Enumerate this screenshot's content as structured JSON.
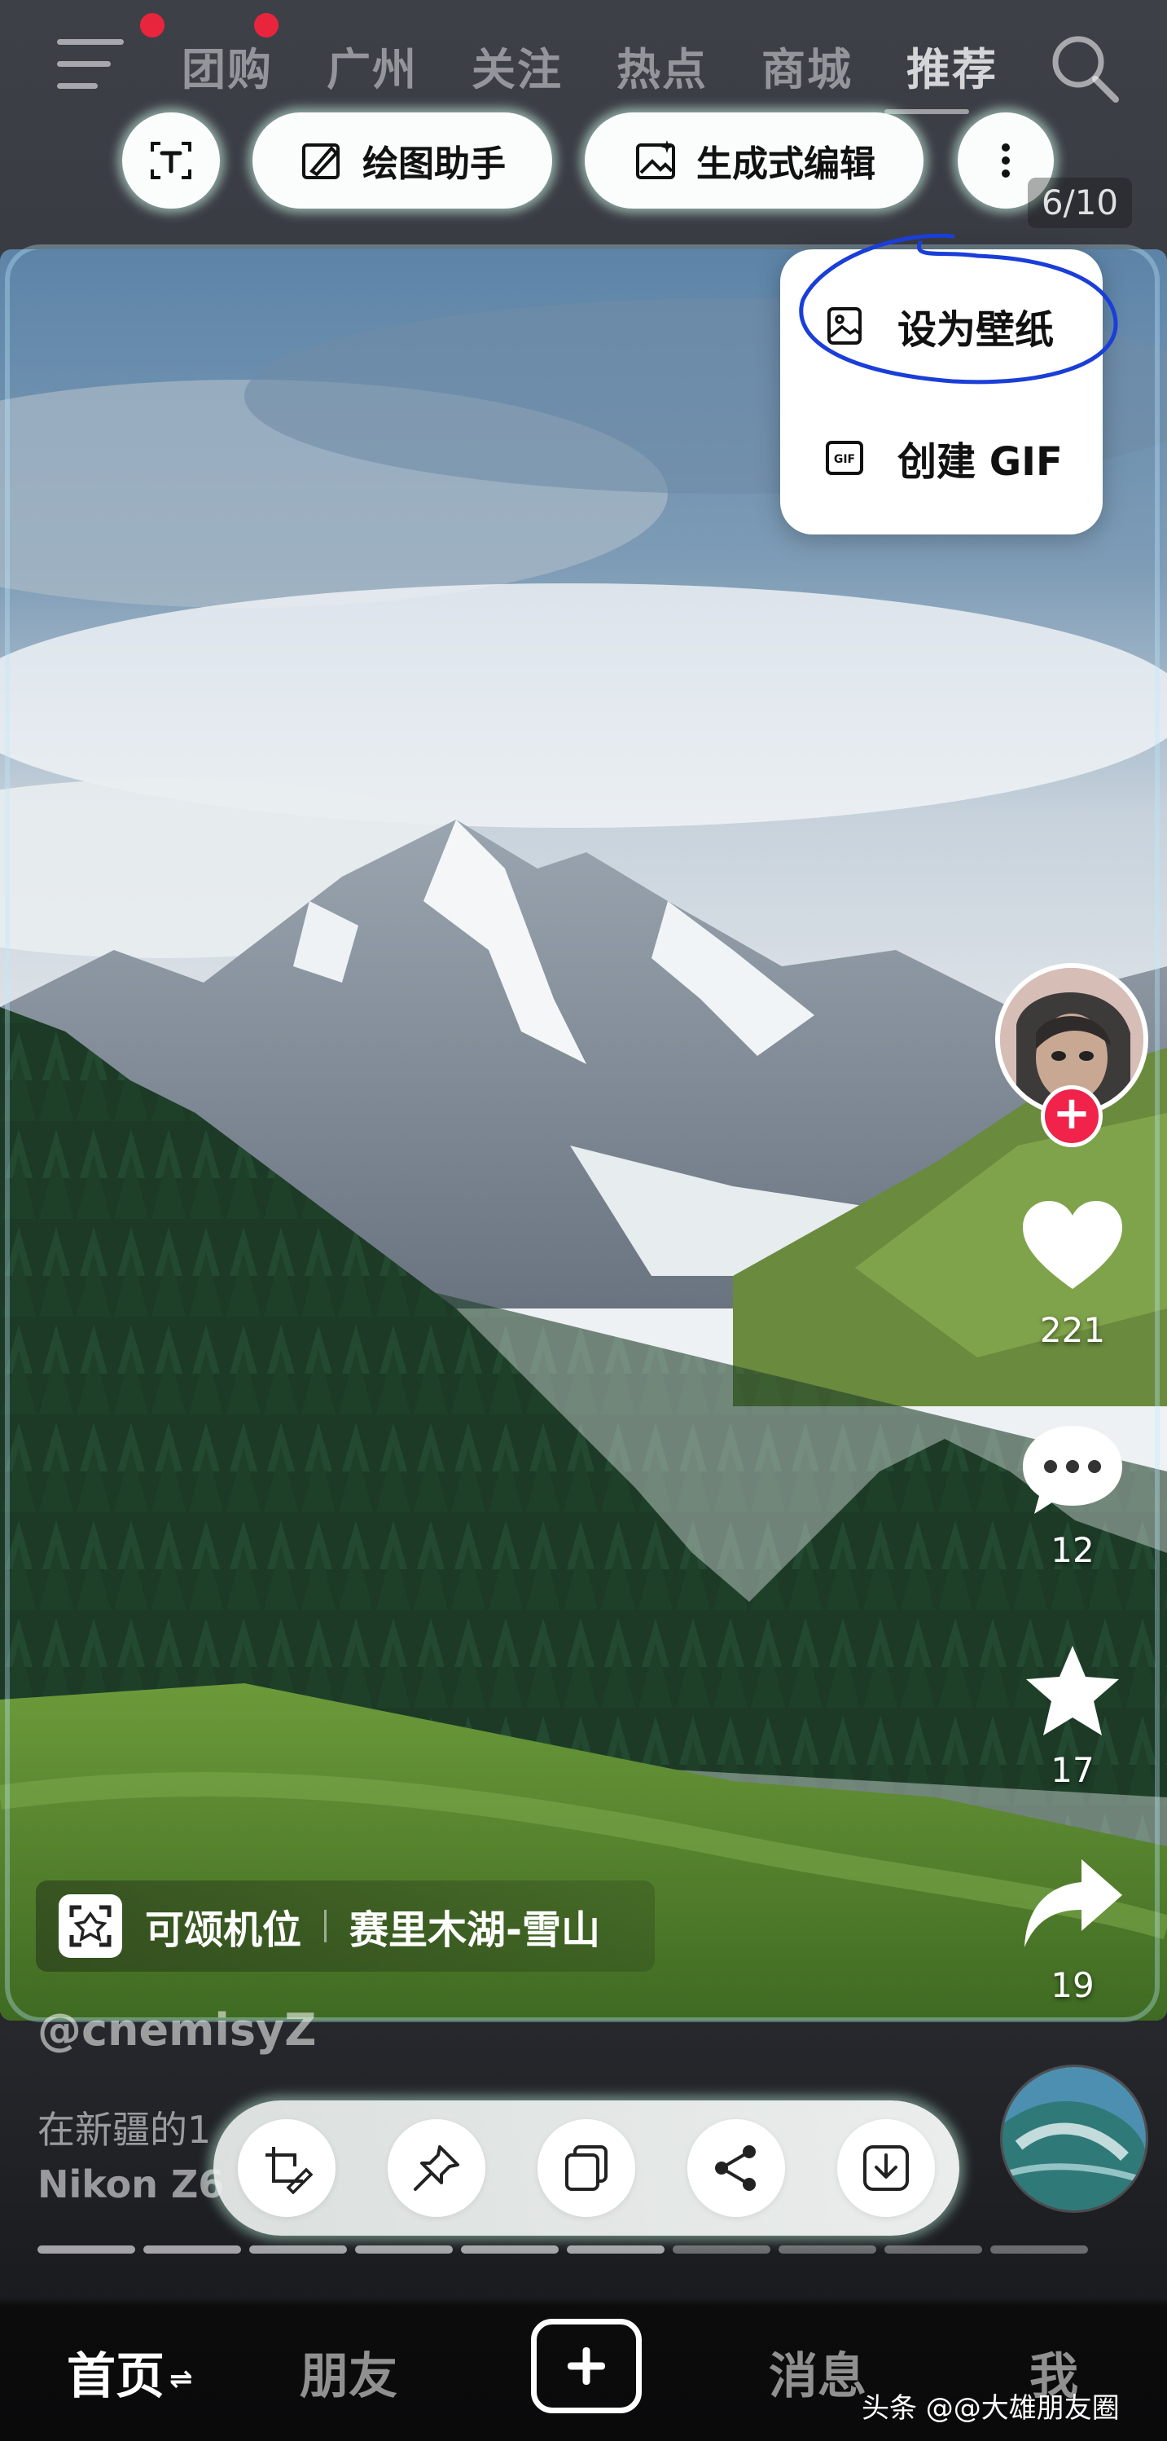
{
  "nav": {
    "tabs": [
      "团购",
      "广州",
      "关注",
      "热点",
      "商城",
      "推荐"
    ],
    "active_tab": "推荐"
  },
  "toolbar": {
    "draw_label": "绘图助手",
    "gen_edit_label": "生成式编辑"
  },
  "page_indicator": "6/10",
  "menu": {
    "items": [
      {
        "label": "设为壁纸",
        "icon": "image-icon"
      },
      {
        "label": "创建 GIF",
        "icon": "gif-icon"
      }
    ]
  },
  "rail": {
    "likes": "221",
    "comments": "12",
    "favorites": "17",
    "shares": "19"
  },
  "location": {
    "prefix": "可颂机位",
    "name": "赛里木湖-雪山"
  },
  "caption": {
    "author": "@cnemisyZ",
    "line1": "在新疆的1",
    "line2": "Nikon Z6"
  },
  "progress": {
    "total": 10,
    "current": 6
  },
  "tabbar": {
    "home": "首页",
    "friends": "朋友",
    "messages": "消息",
    "me": "我"
  },
  "watermark": "头条 @@大雄朋友圈",
  "colors": {
    "accent_red": "#e8253d",
    "follow_red": "#f1234b",
    "ink_blue": "#1a3ed8",
    "pill_glow": "#d2ffeb"
  }
}
